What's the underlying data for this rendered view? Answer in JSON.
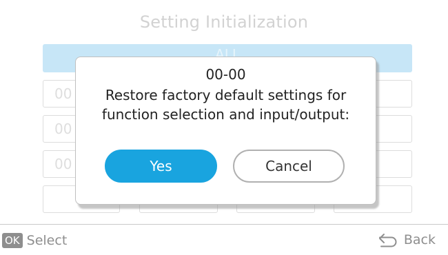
{
  "screen": {
    "title": "Setting Initialization",
    "all_row_label": "ALL",
    "grid": {
      "row1_first": "00",
      "row2_first": "00",
      "row3_first": "00"
    }
  },
  "dialog": {
    "code": "00-00",
    "message_line1": "Restore factory default settings for",
    "message_line2": "function selection and input/output:",
    "yes_label": "Yes",
    "cancel_label": "Cancel"
  },
  "footer": {
    "ok_badge": "OK",
    "select_label": "Select",
    "back_label": "Back",
    "back_icon": "back-arrow-icon"
  },
  "colors": {
    "accent": "#19a4df",
    "highlight_row": "#c7e6f7"
  }
}
